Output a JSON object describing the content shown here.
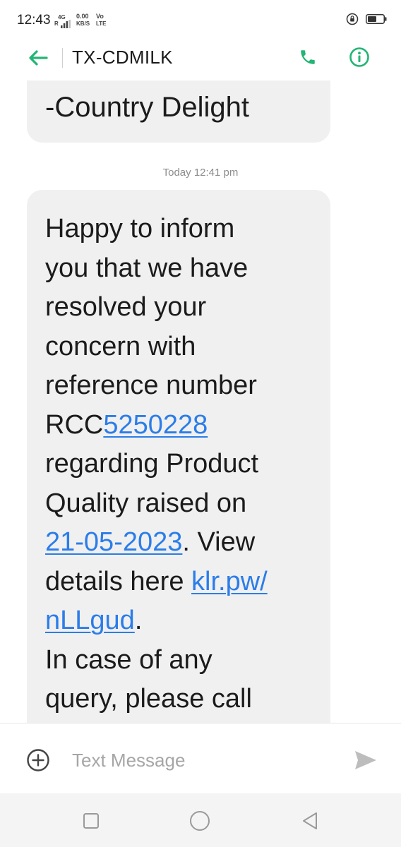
{
  "status_bar": {
    "time": "12:43",
    "network_top": "4G",
    "network_r": "R",
    "speed_value": "0.00",
    "speed_unit": "KB/S",
    "volte_top": "Vo",
    "volte_bottom": "LTE",
    "icons": [
      "signal-icon",
      "rotation-lock-icon",
      "battery-icon"
    ]
  },
  "header": {
    "title": "TX-CDMILK",
    "accent_color": "#22b573"
  },
  "conversation": {
    "previous_message_tail": "-Country Delight",
    "timestamp": "Today 12:41 pm",
    "message": {
      "line1": "Happy to inform",
      "line2": "you that we have",
      "line3": "resolved your",
      "line4": "concern with",
      "line5": "reference number",
      "ref_prefix": "RCC",
      "ref_link": "5250228",
      "line7": "regarding Product",
      "line8": "Quality raised on",
      "date_link": "21-05-2023",
      "after_date": ". View",
      "details_prefix": "details here ",
      "url_part1": "klr.pw/",
      "url_part2": "nLLgud",
      "after_url": ".",
      "line12": "In case of any",
      "line13": "query, please call"
    },
    "link_color": "#2b7de9"
  },
  "compose": {
    "placeholder": "Text Message",
    "value": ""
  },
  "nav_bar": {
    "icons": [
      "recents-square-icon",
      "home-circle-icon",
      "back-triangle-icon"
    ]
  }
}
